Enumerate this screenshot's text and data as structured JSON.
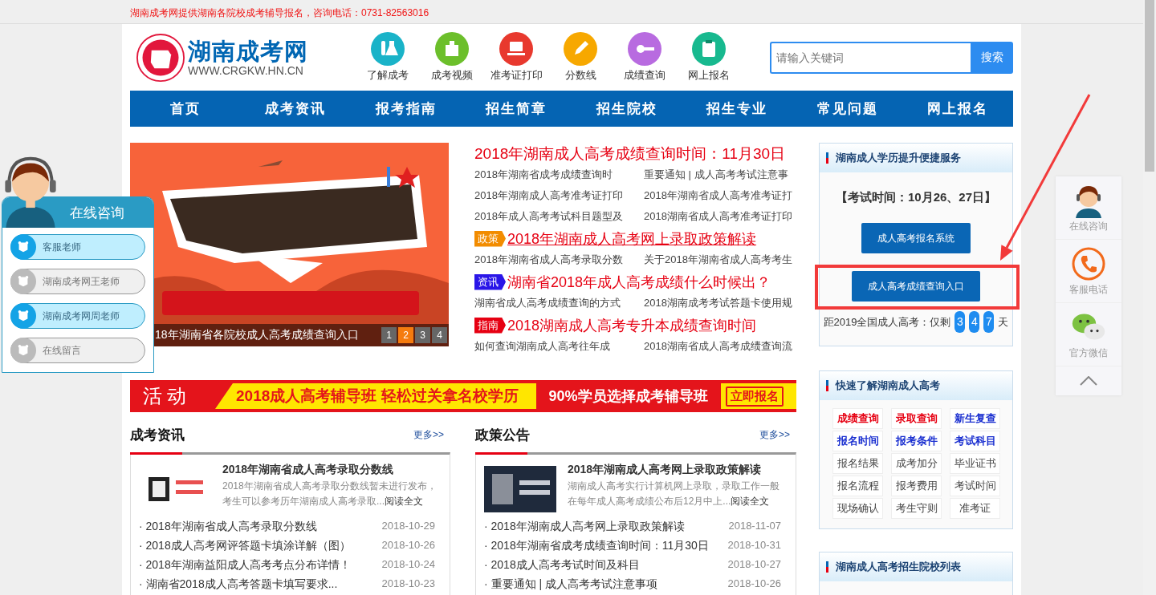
{
  "topbar": {
    "notice": "湖南成考网提供湖南各院校成考辅导报名，咨询电话：0731-82563016"
  },
  "header": {
    "logo": {
      "name": "湖南成考网",
      "url": "WWW.CRGKW.HN.CN"
    },
    "shortcuts": [
      {
        "label": "了解成考",
        "color": "#1ab3c8",
        "kind": "flask"
      },
      {
        "label": "成考视频",
        "color": "#6cbf2b",
        "kind": "building"
      },
      {
        "label": "准考证打印",
        "color": "#e8392e",
        "kind": "laptop"
      },
      {
        "label": "分数线",
        "color": "#f7a800",
        "kind": "pencil"
      },
      {
        "label": "成绩查询",
        "color": "#b86be0",
        "kind": "key"
      },
      {
        "label": "网上报名",
        "color": "#18b98f",
        "kind": "clipboard"
      }
    ],
    "search": {
      "placeholder": "请输入关键词",
      "button": "搜索"
    }
  },
  "nav": [
    "首页",
    "成考资讯",
    "报考指南",
    "招生简章",
    "招生院校",
    "招生专业",
    "常见问题",
    "网上报名"
  ],
  "banner": {
    "caption": "18年湖南省各院校成人高考成绩查询入口",
    "pages": [
      {
        "label": "1",
        "selected": false
      },
      {
        "label": "2",
        "selected": true
      },
      {
        "label": "3",
        "selected": false
      },
      {
        "label": "4",
        "selected": false
      }
    ]
  },
  "headlines": [
    {
      "title": "2018年湖南成人高考成绩查询时间：11月30日",
      "hovered": false,
      "links": [
        "2018年湖南省成考成绩查询时",
        "重要通知 | 成人高考考试注意事",
        "2018年湖南成人高考准考证打印",
        "2018年湖南省成人高考准考证打",
        "2018年成人高考考试科目题型及",
        "2018湖南省成人高考准考证打印"
      ]
    },
    {
      "tag": "政策",
      "color": "#f28c00",
      "title": "2018年湖南成人高考网上录取政策解读",
      "hovered": true,
      "links": [
        "2018年湖南省成人高考录取分数",
        "关于2018年湖南省成人高考考生"
      ]
    },
    {
      "tag": "资讯",
      "color": "#2a16e8",
      "title": "湖南省2018年成人高考成绩什么时候出？",
      "hovered": false,
      "links": [
        "湖南省成人高考成绩查询的方式",
        "2018湖南成考考试答题卡使用规"
      ]
    },
    {
      "tag": "指南",
      "color": "#e60012",
      "title": "2018湖南成人高考专升本成绩查询时间",
      "hovered": false,
      "links": [
        "如何查询湖南成人高考往年成",
        "2018湖南省成人高考成绩查询流"
      ]
    }
  ],
  "promo": {
    "tag": "活动",
    "text": "2018成人高考辅导班 轻松过关拿名校学历",
    "slogan": "90%学员选择成考辅导班",
    "button": "立即报名"
  },
  "sections": [
    {
      "title": "成考资讯",
      "more": "更多>>",
      "feature": {
        "kind": "light",
        "title": "2018年湖南省成人高考录取分数线",
        "summary": "2018年湖南省成人高考录取分数线暂未进行发布，考生可以参考历年湖南成人高考录取...",
        "read_more": "阅读全文"
      },
      "items": [
        {
          "text": "· 2018年湖南省成人高考录取分数线",
          "date": "2018-10-29"
        },
        {
          "text": "· 2018成人高考网评答题卡填涂详解（图）",
          "date": "2018-10-26"
        },
        {
          "text": "· 2018年湖南益阳成人高考考点分布详情！",
          "date": "2018-10-24"
        },
        {
          "text": "· 湖南省2018成人高考答题卡填写要求...",
          "date": "2018-10-23"
        }
      ]
    },
    {
      "title": "政策公告",
      "more": "更多>>",
      "feature": {
        "kind": "dark",
        "title": "2018年湖南成人高考网上录取政策解读",
        "summary": "湖南成人高考实行计算机网上录取，录取工作一般在每年成人高考成绩公布后12月中上...",
        "read_more": "阅读全文"
      },
      "items": [
        {
          "text": "· 2018年湖南成人高考网上录取政策解读",
          "date": "2018-11-07"
        },
        {
          "text": "· 2018年湖南省成考成绩查询时间：11月30日",
          "date": "2018-10-31"
        },
        {
          "text": "· 2018成人高考考试时间及科目",
          "date": "2018-10-27"
        },
        {
          "text": "· 重要通知 | 成人高考考试注意事项",
          "date": "2018-10-26"
        }
      ]
    }
  ],
  "sidebar": {
    "service": {
      "title": "湖南成人学历提升便捷服务",
      "exam_time": "【考试时间：10月26、27日】",
      "buttons": [
        {
          "label": "成人高考报名系统",
          "highlighted": false
        },
        {
          "label": "成人高考成绩查询入口",
          "highlighted": true
        }
      ],
      "countdown": {
        "prefix": "距2019全国成人高考：仅剩",
        "digits": [
          "3",
          "4",
          "7"
        ],
        "suffix": "天"
      }
    },
    "quick": {
      "title": "快速了解湖南成人高考",
      "links": [
        {
          "label": "成绩查询",
          "color": "#e60012",
          "kind": "hot"
        },
        {
          "label": "录取查询",
          "color": "#e60012",
          "kind": "hot"
        },
        {
          "label": "新生复查",
          "color": "#1a2fd0",
          "kind": "hot"
        },
        {
          "label": "报名时间",
          "color": "#1a2fd0",
          "kind": "hot"
        },
        {
          "label": "报考条件",
          "color": "#1a2fd0",
          "kind": "hot"
        },
        {
          "label": "考试科目",
          "color": "#1a2fd0",
          "kind": "hot"
        },
        {
          "label": "报名结果",
          "color": "#444444",
          "kind": "plain"
        },
        {
          "label": "成考加分",
          "color": "#444444",
          "kind": "plain"
        },
        {
          "label": "毕业证书",
          "color": "#444444",
          "kind": "plain"
        },
        {
          "label": "报名流程",
          "color": "#444444",
          "kind": "plain"
        },
        {
          "label": "报考费用",
          "color": "#444444",
          "kind": "plain"
        },
        {
          "label": "考试时间",
          "color": "#444444",
          "kind": "plain"
        },
        {
          "label": "现场确认",
          "color": "#444444",
          "kind": "plain"
        },
        {
          "label": "考生守则",
          "color": "#444444",
          "kind": "plain"
        },
        {
          "label": "准考证",
          "color": "#444444",
          "kind": "plain"
        }
      ]
    },
    "colleges": {
      "title": "湖南成人高考招生院校列表"
    }
  },
  "chat": {
    "title": "在线咨询",
    "agents": [
      {
        "label": "客服老师",
        "online": true
      },
      {
        "label": "湖南成考网王老师",
        "online": false
      },
      {
        "label": "湖南成考网周老师",
        "online": true
      },
      {
        "label": "在线留言",
        "online": false
      }
    ]
  },
  "float_bar": {
    "items": [
      {
        "kind": "agent",
        "label": "在线咨询"
      },
      {
        "kind": "phone",
        "label": "客服电话"
      },
      {
        "kind": "wechat",
        "label": "官方微信"
      }
    ]
  }
}
